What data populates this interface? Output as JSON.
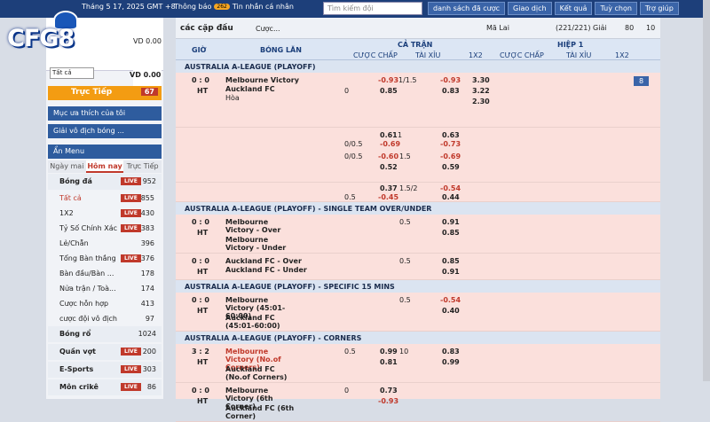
{
  "topbar": {
    "date": "Tháng 5 17, 2025 GMT +8",
    "notice": "Thông báo",
    "notice_count": "262",
    "msg": "Tin nhắn cá nhân",
    "search_placeholder": "Tìm kiếm đội",
    "buttons": [
      "danh sách đã cược",
      "Giao dịch",
      "Kết quả",
      "Tuỳ chọn",
      "Trợ giúp"
    ]
  },
  "logo": {
    "text": "CFG8"
  },
  "account": {
    "balance1": "VD 0.00",
    "balance2": "VD 0.00",
    "select": "Tất cả"
  },
  "live": {
    "label": "Trực Tiếp",
    "count": "67"
  },
  "side_btns": [
    "Mục ưa thích của tôi",
    "Giải vô địch bóng ..."
  ],
  "menu_label": "Ẩn Menu",
  "tabs": [
    "Ngày mai",
    "Hôm nay",
    "Trực Tiếp"
  ],
  "sports": [
    {
      "name": "Bóng đá",
      "live": "LIVE",
      "n": "952"
    },
    {
      "name": "Bóng rổ",
      "live": "",
      "n": "1024"
    },
    {
      "name": "Quần vợt",
      "live": "LIVE",
      "n": "200"
    },
    {
      "name": "E-Sports",
      "live": "LIVE",
      "n": "303"
    },
    {
      "name": "Môn crikê",
      "live": "LIVE",
      "n": "86"
    }
  ],
  "subs": [
    {
      "name": "Tất cả",
      "live": "LIVE",
      "n": "855"
    },
    {
      "name": "1X2",
      "live": "LIVE",
      "n": "430"
    },
    {
      "name": "Tỷ Số Chính Xác",
      "live": "LIVE",
      "n": "383"
    },
    {
      "name": "Lẻ/Chẵn",
      "live": "",
      "n": "396"
    },
    {
      "name": "Tổng Bàn thắng",
      "live": "LIVE",
      "n": "376"
    },
    {
      "name": "Bàn đầu/Bàn ...",
      "live": "",
      "n": "178"
    },
    {
      "name": "Nửa trận / Toà...",
      "live": "",
      "n": "174"
    },
    {
      "name": "Cược hỗn hợp",
      "live": "",
      "n": "413"
    },
    {
      "name": "cược đội vô địch",
      "live": "",
      "n": "97"
    }
  ],
  "toolbar": {
    "title": "các cặp đấu",
    "bet": "Cược...",
    "odds": "Mã Lai",
    "count": "(221/221) Giải",
    "c80": "80",
    "c10": "10"
  },
  "header": {
    "time": "GIỜ",
    "match": "BÓNG LĂN",
    "full": "CẢ TRẬN",
    "half": "HIỆP 1",
    "hdp": "CƯỢC CHẤP",
    "ou": "TÀI XỈU",
    "x12": "1X2"
  },
  "leagues": [
    "AUSTRALIA A-LEAGUE (PLAYOFF)",
    "AUSTRALIA A-LEAGUE (PLAYOFF) - SINGLE TEAM OVER/UNDER",
    "AUSTRALIA A-LEAGUE (PLAYOFF) - SPECIFIC 15 MINS",
    "AUSTRALIA A-LEAGUE (PLAYOFF) - CORNERS"
  ],
  "m1": {
    "score": "0 : 0",
    "ht": "HT",
    "home": "Melbourne Victory",
    "away": "Auckland FC",
    "draw": "Hòa",
    "more": "8"
  },
  "m2": {
    "score": "0 : 0",
    "ht": "HT",
    "home": "Melbourne Victory - Over",
    "away": "Melbourne Victory - Under"
  },
  "m3": {
    "score": "0 : 0",
    "ht": "HT",
    "home": "Auckland FC - Over",
    "away": "Auckland FC - Under"
  },
  "m4": {
    "score": "0 : 0",
    "ht": "HT",
    "home": "Melbourne Victory (45:01-60:00)",
    "away": "Auckland FC (45:01-60:00)"
  },
  "m5": {
    "score": "3 : 2",
    "ht": "HT",
    "home": "Melbourne Victory (No.of Corners)",
    "away": "Auckland FC (No.of Corners)"
  },
  "m6": {
    "score": "0 : 0",
    "ht": "HT",
    "home": "Melbourne Victory (6th Corner)",
    "away": "Auckland FC (6th Corner)"
  }
}
